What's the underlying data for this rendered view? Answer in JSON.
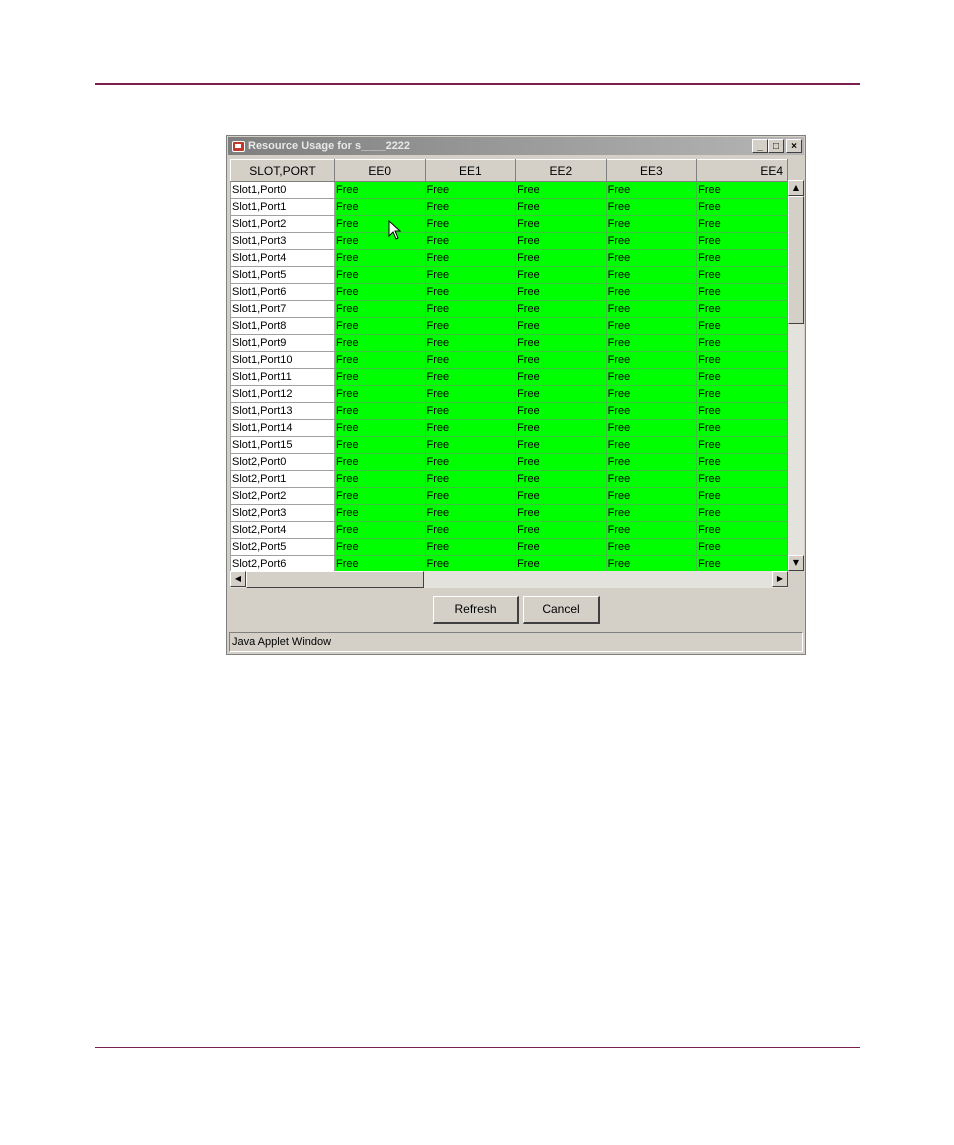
{
  "window": {
    "title": "Resource Usage for s____2222",
    "buttons": {
      "minimize": "_",
      "maximize": "□",
      "close": "×"
    }
  },
  "table": {
    "columns": [
      "SLOT,PORT",
      "EE0",
      "EE1",
      "EE2",
      "EE3",
      "EE4"
    ],
    "rows": [
      {
        "label": "Slot1,Port0",
        "cells": [
          "Free",
          "Free",
          "Free",
          "Free",
          "Free"
        ]
      },
      {
        "label": "Slot1,Port1",
        "cells": [
          "Free",
          "Free",
          "Free",
          "Free",
          "Free"
        ]
      },
      {
        "label": "Slot1,Port2",
        "cells": [
          "Free",
          "Free",
          "Free",
          "Free",
          "Free"
        ]
      },
      {
        "label": "Slot1,Port3",
        "cells": [
          "Free",
          "Free",
          "Free",
          "Free",
          "Free"
        ]
      },
      {
        "label": "Slot1,Port4",
        "cells": [
          "Free",
          "Free",
          "Free",
          "Free",
          "Free"
        ]
      },
      {
        "label": "Slot1,Port5",
        "cells": [
          "Free",
          "Free",
          "Free",
          "Free",
          "Free"
        ]
      },
      {
        "label": "Slot1,Port6",
        "cells": [
          "Free",
          "Free",
          "Free",
          "Free",
          "Free"
        ]
      },
      {
        "label": "Slot1,Port7",
        "cells": [
          "Free",
          "Free",
          "Free",
          "Free",
          "Free"
        ]
      },
      {
        "label": "Slot1,Port8",
        "cells": [
          "Free",
          "Free",
          "Free",
          "Free",
          "Free"
        ]
      },
      {
        "label": "Slot1,Port9",
        "cells": [
          "Free",
          "Free",
          "Free",
          "Free",
          "Free"
        ]
      },
      {
        "label": "Slot1,Port10",
        "cells": [
          "Free",
          "Free",
          "Free",
          "Free",
          "Free"
        ]
      },
      {
        "label": "Slot1,Port11",
        "cells": [
          "Free",
          "Free",
          "Free",
          "Free",
          "Free"
        ]
      },
      {
        "label": "Slot1,Port12",
        "cells": [
          "Free",
          "Free",
          "Free",
          "Free",
          "Free"
        ]
      },
      {
        "label": "Slot1,Port13",
        "cells": [
          "Free",
          "Free",
          "Free",
          "Free",
          "Free"
        ]
      },
      {
        "label": "Slot1,Port14",
        "cells": [
          "Free",
          "Free",
          "Free",
          "Free",
          "Free"
        ]
      },
      {
        "label": "Slot1,Port15",
        "cells": [
          "Free",
          "Free",
          "Free",
          "Free",
          "Free"
        ]
      },
      {
        "label": "Slot2,Port0",
        "cells": [
          "Free",
          "Free",
          "Free",
          "Free",
          "Free"
        ]
      },
      {
        "label": "Slot2,Port1",
        "cells": [
          "Free",
          "Free",
          "Free",
          "Free",
          "Free"
        ]
      },
      {
        "label": "Slot2,Port2",
        "cells": [
          "Free",
          "Free",
          "Free",
          "Free",
          "Free"
        ]
      },
      {
        "label": "Slot2,Port3",
        "cells": [
          "Free",
          "Free",
          "Free",
          "Free",
          "Free"
        ]
      },
      {
        "label": "Slot2,Port4",
        "cells": [
          "Free",
          "Free",
          "Free",
          "Free",
          "Free"
        ]
      },
      {
        "label": "Slot2,Port5",
        "cells": [
          "Free",
          "Free",
          "Free",
          "Free",
          "Free"
        ]
      },
      {
        "label": "Slot2,Port6",
        "cells": [
          "Free",
          "Free",
          "Free",
          "Free",
          "Free"
        ]
      }
    ]
  },
  "buttons": {
    "refresh": "Refresh",
    "cancel": "Cancel"
  },
  "status": "Java Applet Window",
  "colors": {
    "free": "#00ff00",
    "rule": "#7a1f4f"
  },
  "icons": {
    "app": "java-cup-icon",
    "scroll_up": "▲",
    "scroll_down": "▼",
    "scroll_left": "◀",
    "scroll_right": "▶"
  }
}
